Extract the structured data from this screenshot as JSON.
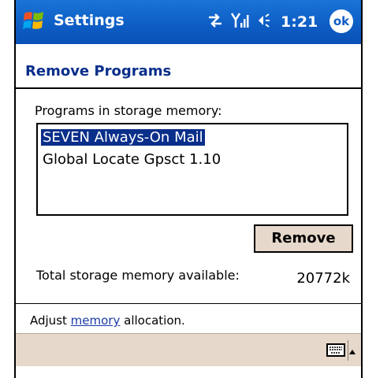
{
  "titlebar": {
    "title": "Settings",
    "time": "1:21",
    "ok_label": "ok",
    "bg_color": "#0d5cc4"
  },
  "page": {
    "header": "Remove Programs",
    "programs_label": "Programs in storage memory:",
    "programs": [
      {
        "name": "SEVEN Always-On Mail",
        "selected": true
      },
      {
        "name": "Global Locate Gpsct 1.10",
        "selected": false
      }
    ],
    "remove_button": "Remove",
    "total_label": "Total storage memory available:",
    "total_value": "20772k"
  },
  "footer": {
    "adjust_prefix": "Adjust ",
    "adjust_link": "memory",
    "adjust_suffix": " allocation.",
    "menubar_color": "#e6d8ca"
  },
  "icons": [
    "windows-start-icon",
    "sync-arrows-icon",
    "signal-antenna-icon",
    "speaker-icon",
    "ok-icon",
    "keyboard-icon",
    "sip-up-arrow-icon"
  ]
}
